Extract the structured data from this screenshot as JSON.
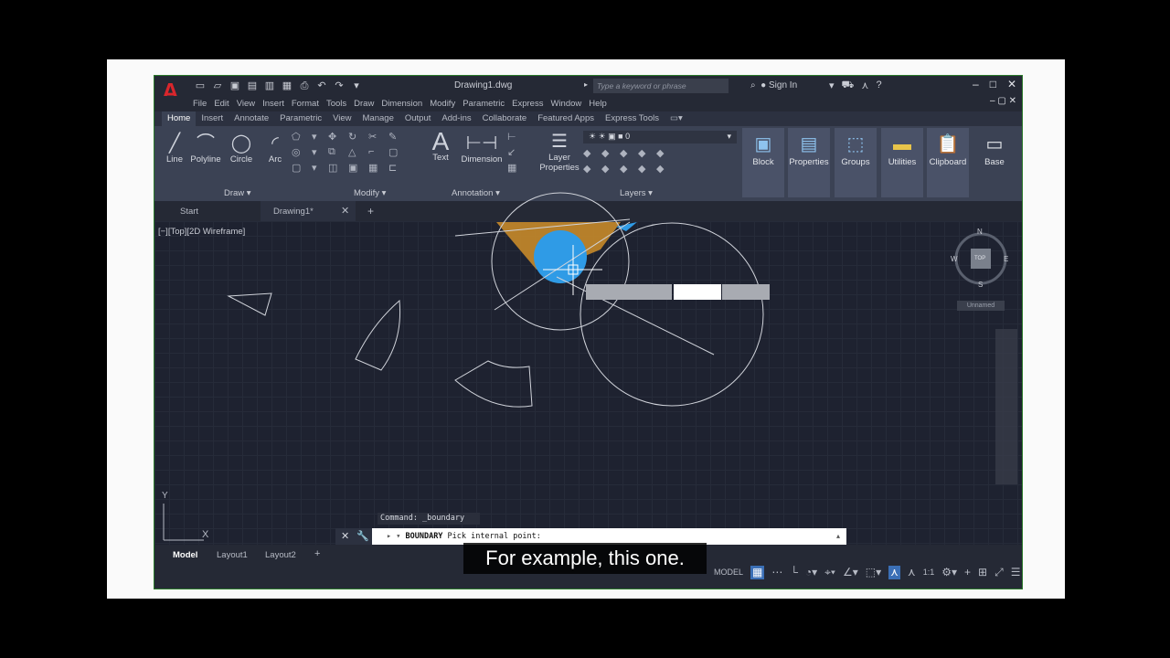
{
  "app": {
    "title": "Drawing1.dwg",
    "search_placeholder": "Type a keyword or phrase",
    "sign_in": "Sign In"
  },
  "menu": [
    "File",
    "Edit",
    "View",
    "Insert",
    "Format",
    "Tools",
    "Draw",
    "Dimension",
    "Modify",
    "Parametric",
    "Window",
    "Help"
  ],
  "ribbon_tabs": [
    "Home",
    "Insert",
    "Annotate",
    "Parametric",
    "View",
    "Manage",
    "Output",
    "Add-ins",
    "Collaborate",
    "Featured Apps",
    "Express Tools"
  ],
  "active_ribbon_tab": "Home",
  "extra_menu": "Express",
  "draw_tools": [
    "Line",
    "Polyline",
    "Circle",
    "Arc"
  ],
  "annotation_tools": [
    "Text",
    "Dimension"
  ],
  "layer_tool": "Layer Properties",
  "layer_value": "0",
  "panel_big_buttons": [
    "Block",
    "Properties",
    "Groups",
    "Utilities",
    "Clipboard",
    "Base"
  ],
  "panel_titles": {
    "draw": "Draw",
    "modify": "Modify",
    "annotation": "Annotation",
    "layers": "Layers"
  },
  "file_tabs": {
    "start": "Start",
    "drawing": "Drawing1*"
  },
  "view_label": "[−][Top][2D Wireframe]",
  "viewcube": {
    "n": "N",
    "s": "S",
    "e": "E",
    "w": "W",
    "top": "TOP",
    "unnamed": "Unnamed"
  },
  "ucs": {
    "x": "X",
    "y": "Y"
  },
  "command": {
    "history": "Command: _boundary",
    "prompt_bold": "BOUNDARY",
    "prompt_text": " Pick internal point:"
  },
  "layout_tabs": [
    "Model",
    "Layout1",
    "Layout2"
  ],
  "status": {
    "model": "MODEL",
    "scale": "1:1"
  },
  "subtitle": "For example, this one.",
  "colors": {
    "accent_hatch_blue": "#2f9be6",
    "hatch_orange": "#c68a2a",
    "canvas": "#1e2230"
  }
}
